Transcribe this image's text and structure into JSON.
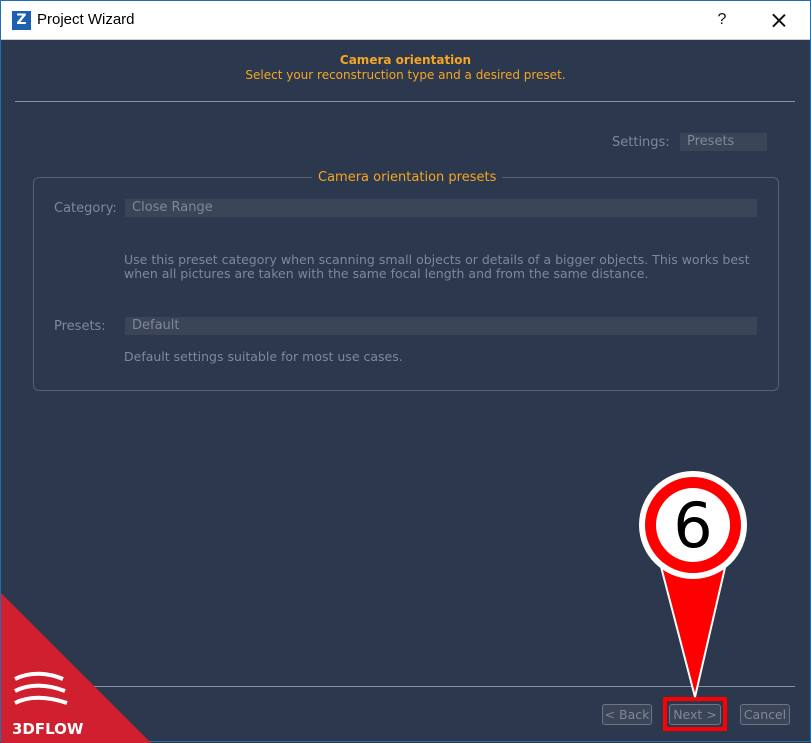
{
  "window": {
    "app_icon_letter": "Z",
    "title": "Project Wizard",
    "help_label": "?"
  },
  "header": {
    "title": "Camera orientation",
    "subtitle": "Select your reconstruction type and a desired preset."
  },
  "settings": {
    "label": "Settings:",
    "value": "Presets"
  },
  "group": {
    "title": "Camera orientation presets",
    "category_label": "Category:",
    "category_value": "Close Range",
    "category_description_line1": "Use this preset category when scanning small objects or details of a bigger objects. This works best",
    "category_description_line2": "when all pictures are taken with the same focal length and from the same distance.",
    "presets_label": "Presets:",
    "presets_value": "Default",
    "presets_description": "Default settings suitable for most use cases."
  },
  "footer": {
    "back_label": "< Back",
    "next_label": "Next >",
    "cancel_label": "Cancel"
  },
  "annotation": {
    "step_number": "6",
    "color": "#ff0000"
  },
  "logo": {
    "text": "3DFLOW",
    "color": "#d01f2e"
  },
  "colors": {
    "accent": "#f5a623",
    "background": "#2c384d",
    "disabled_text": "#7f8899"
  }
}
